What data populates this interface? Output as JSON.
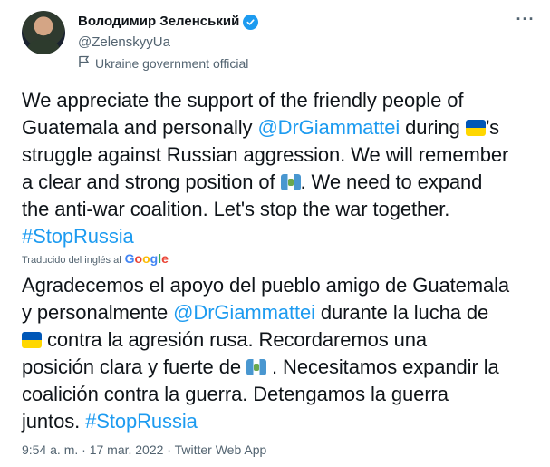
{
  "author": {
    "name": "Володимир Зеленський",
    "handle": "@ZelenskyyUa",
    "label": "Ukraine government official"
  },
  "tweet_lines": [
    "We appreciate the support of the friendly people of",
    "Guatemala and personally ",
    " during ",
    "’s",
    "struggle against Russian aggression. We will remember",
    "a clear and strong position of ",
    ". We need to expand",
    "the anti-war coalition. Let's stop the war together."
  ],
  "mention": "@DrGiammattei",
  "hashtag": "#StopRussia",
  "translated_by": "Traducido del inglés al",
  "google_logo": "Google",
  "translation_lines": [
    "Agradecemos el apoyo del pueblo amigo de Guatemala",
    "y personalmente ",
    " durante la lucha de",
    " contra la agresión rusa. Recordaremos una",
    "posición clara y fuerte de ",
    " . Necesitamos expandir la",
    "coalición contra la guerra. Detengamos la guerra",
    "juntos. "
  ],
  "meta": "9:54 a. m. · 17 mar. 2022 · Twitter Web App",
  "icons": {
    "verified": "verified-badge-icon",
    "label": "flag-outline-icon",
    "more": "more-options-icon",
    "ukraine_flag": "ukraine-flag-icon",
    "guatemala_flag": "guatemala-flag-icon"
  },
  "colors": {
    "accent": "#1d9bf0",
    "secondary_text": "#536471",
    "primary_text": "#0f1419"
  }
}
